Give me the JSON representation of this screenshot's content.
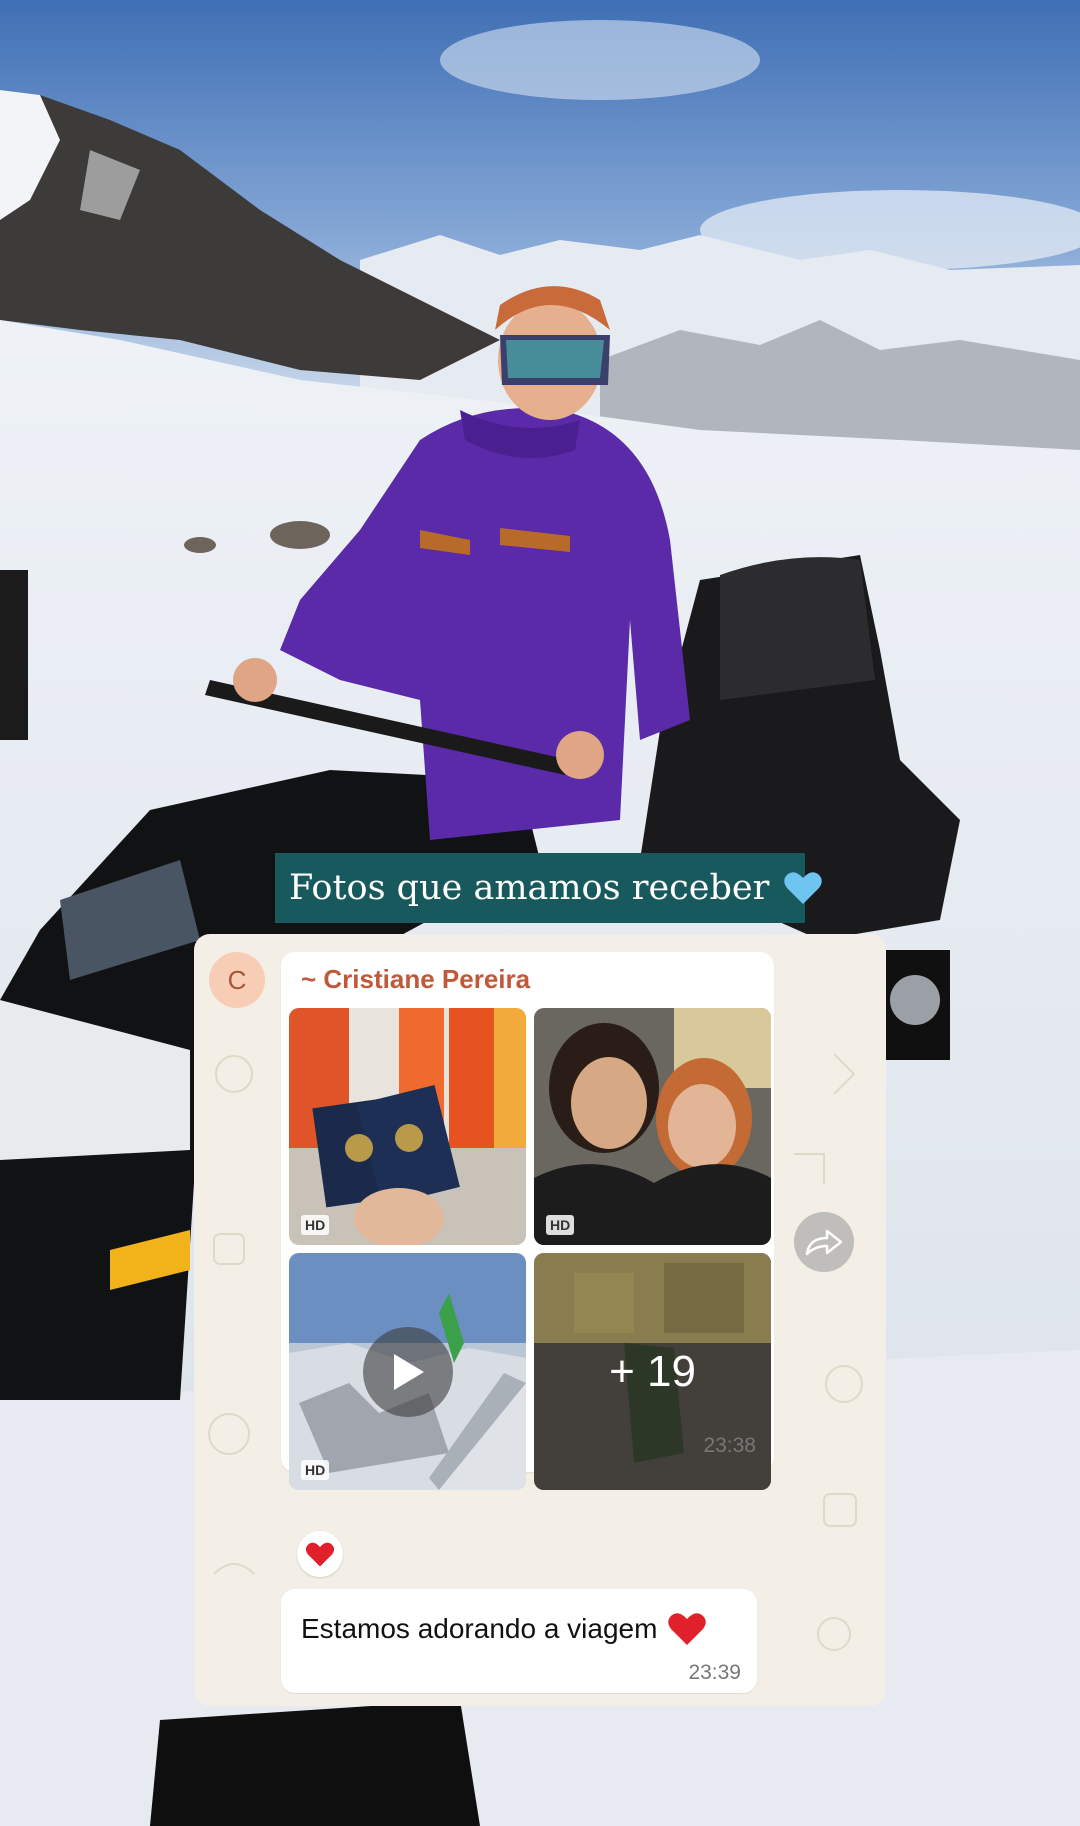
{
  "story": {
    "caption": "Fotos que amamos receber",
    "caption_emoji": "light-blue-heart"
  },
  "chat": {
    "avatar_letter": "C",
    "sender_name": "~ Cristiane Pereira",
    "media": [
      {
        "kind": "photo",
        "description": "passports-icon",
        "hd": "HD"
      },
      {
        "kind": "photo",
        "description": "selfie-two-women",
        "hd": "HD"
      },
      {
        "kind": "video",
        "description": "airplane-window-mountains",
        "hd": "HD"
      },
      {
        "kind": "photo",
        "description": "street-photo",
        "more": "+ 19"
      }
    ],
    "media_time": "23:38",
    "reaction": "red-heart",
    "message": {
      "text": "Estamos adorando a viagem",
      "emoji": "red-heart",
      "time": "23:39"
    }
  },
  "colors": {
    "caption_bg": "#17595c",
    "sender": "#c0583a",
    "chat_bg": "#f4efe6",
    "jacket": "#5a2aa8"
  }
}
